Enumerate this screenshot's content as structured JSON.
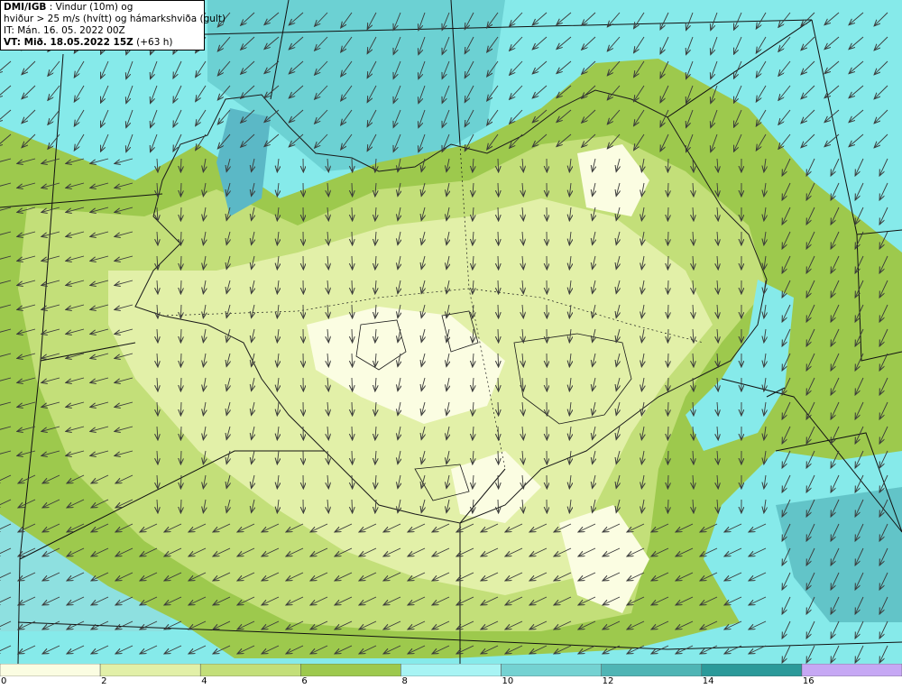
{
  "header": {
    "source": "DMI/IGB",
    "line1_rest": " : Vindur (10m) og",
    "line2": "hviður > 25 m/s (hvítt) og hámarkshviða (gult)",
    "line3": "IT: Mán. 16. 05. 2022 00Z",
    "line4_label": "VT: Mið. 18.05.2022 15Z",
    "line4_rest": " (+63 h)"
  },
  "legend": {
    "bins": [
      {
        "from": 0,
        "to": 2,
        "color": "#fbfde2"
      },
      {
        "from": 2,
        "to": 4,
        "color": "#e2f0a8"
      },
      {
        "from": 4,
        "to": 6,
        "color": "#c3df79"
      },
      {
        "from": 6,
        "to": 8,
        "color": "#9dc94d"
      },
      {
        "from": 8,
        "to": 10,
        "color": "#a8f4f4"
      },
      {
        "from": 10,
        "to": 12,
        "color": "#74d2d2"
      },
      {
        "from": 12,
        "to": 14,
        "color": "#4fb5b5"
      },
      {
        "from": 14,
        "to": 16,
        "color": "#2b9a9a"
      },
      {
        "from": 16,
        "to": 18,
        "color": "#c6a8f4"
      }
    ],
    "tick_labels": [
      "0",
      "2",
      "4",
      "6",
      "8",
      "10",
      "12",
      "14",
      "16"
    ]
  },
  "colors": {
    "sea_light": "#7fe6e6",
    "sea_deep": "#5ec8cc",
    "land_outline": "#1a1a1a",
    "arrow": "#3a3a3a",
    "grid_line": "#111111"
  },
  "map": {
    "wind_direction": "mostly southerly-to-south-westerly flow toward south over land, westerly over sea",
    "icons": [
      "wind-arrow-icon"
    ]
  }
}
